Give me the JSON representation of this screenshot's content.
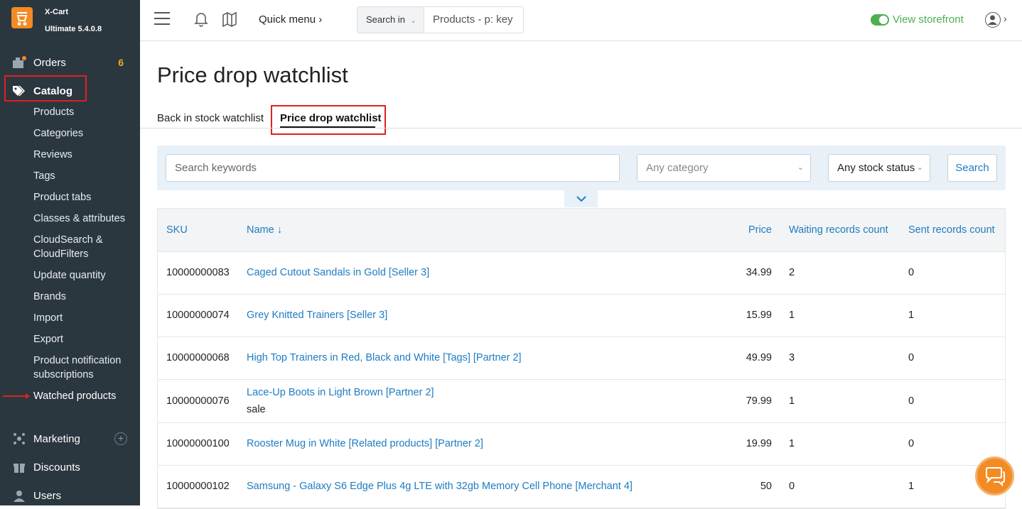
{
  "brand": {
    "name": "X-Cart",
    "edition": "Ultimate 5.4.0.8"
  },
  "sidebar": {
    "orders": {
      "label": "Orders",
      "count": "6"
    },
    "catalog": {
      "label": "Catalog"
    },
    "catalog_items": [
      "Products",
      "Categories",
      "Reviews",
      "Tags",
      "Product tabs",
      "Classes & attributes",
      "CloudSearch &",
      "CloudFilters",
      "Update quantity",
      "Brands",
      "Import",
      "Export",
      "Product notification",
      "subscriptions",
      "Watched products"
    ],
    "marketing": {
      "label": "Marketing"
    },
    "discounts": {
      "label": "Discounts"
    },
    "users": {
      "label": "Users"
    }
  },
  "header": {
    "quick_menu": "Quick menu",
    "search_in": "Search in",
    "search_placeholder": "Products - p: key",
    "view_storefront": "View storefront"
  },
  "page": {
    "title": "Price drop watchlist",
    "tabs": [
      "Back in stock watchlist",
      "Price drop watchlist"
    ]
  },
  "filters": {
    "keywords_placeholder": "Search keywords",
    "category": "Any category",
    "stock": "Any stock status",
    "search_button": "Search"
  },
  "table": {
    "columns": {
      "sku": "SKU",
      "name": "Name",
      "price": "Price",
      "waiting": "Waiting records count",
      "sent": "Sent records count"
    },
    "rows": [
      {
        "sku": "10000000083",
        "name": "Caged Cutout Sandals in Gold [Seller 3]",
        "note": "",
        "price": "34.99",
        "waiting": "2",
        "sent": "0"
      },
      {
        "sku": "10000000074",
        "name": "Grey Knitted Trainers [Seller 3]",
        "note": "",
        "price": "15.99",
        "waiting": "1",
        "sent": "1"
      },
      {
        "sku": "10000000068",
        "name": "High Top Trainers in Red, Black and White [Tags] [Partner 2]",
        "note": "",
        "price": "49.99",
        "waiting": "3",
        "sent": "0"
      },
      {
        "sku": "10000000076",
        "name": "Lace-Up Boots in Light Brown [Partner 2]",
        "note": "sale",
        "price": "79.99",
        "waiting": "1",
        "sent": "0"
      },
      {
        "sku": "10000000100",
        "name": "Rooster Mug in White [Related products] [Partner 2]",
        "note": "",
        "price": "19.99",
        "waiting": "1",
        "sent": "0"
      },
      {
        "sku": "10000000102",
        "name": "Samsung - Galaxy S6 Edge Plus 4g LTE with 32gb Memory Cell Phone [Merchant 4]",
        "note": "",
        "price": "50",
        "waiting": "0",
        "sent": "1"
      }
    ]
  },
  "colors": {
    "accent": "#1e7cc2",
    "sidebar": "#2b373f",
    "brand": "#f28b24",
    "highlight": "#e02020",
    "storefront": "#4caf50"
  }
}
